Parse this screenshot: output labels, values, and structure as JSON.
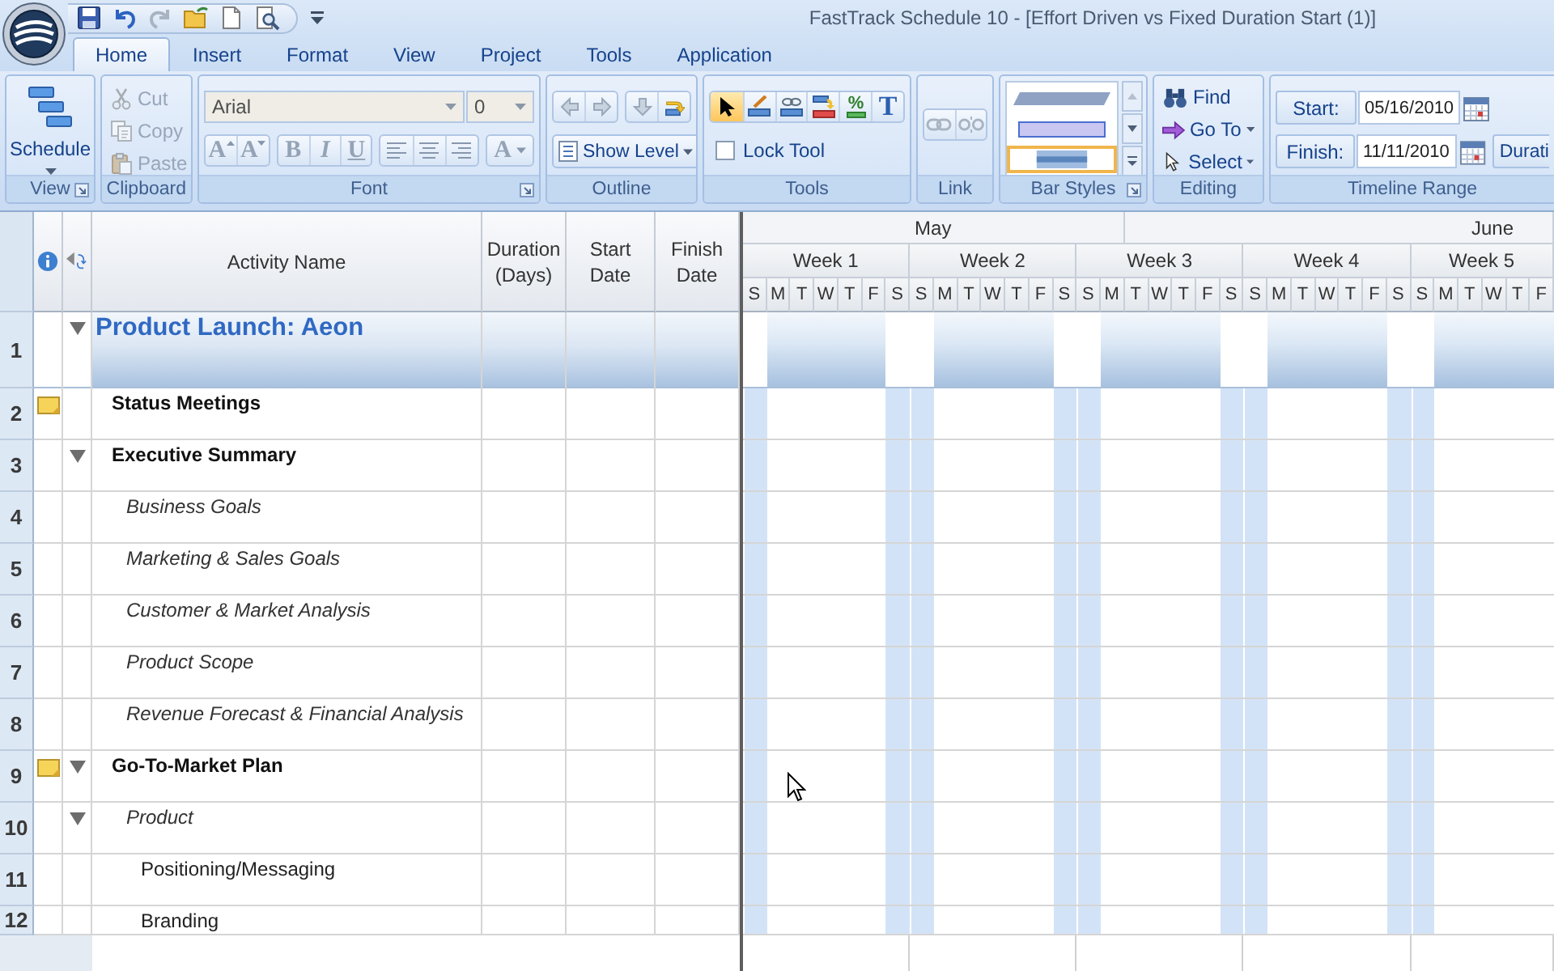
{
  "window": {
    "title": "FastTrack Schedule 10 - [Effort Driven vs Fixed Duration Start (1)]"
  },
  "ribbon_tabs": [
    {
      "label": "Home",
      "selected": true
    },
    {
      "label": "Insert",
      "selected": false
    },
    {
      "label": "Format",
      "selected": false
    },
    {
      "label": "View",
      "selected": false
    },
    {
      "label": "Project",
      "selected": false
    },
    {
      "label": "Tools",
      "selected": false
    },
    {
      "label": "Application",
      "selected": false
    }
  ],
  "ribbon_groups": [
    {
      "kind": "view",
      "label": "View",
      "launcher": true,
      "button": {
        "label": "Schedule"
      }
    },
    {
      "kind": "clipboard",
      "label": "Clipboard",
      "launcher": false,
      "items": [
        {
          "label": "Cut",
          "disabled": true
        },
        {
          "label": "Copy",
          "disabled": true
        },
        {
          "label": "Paste",
          "disabled": true
        }
      ]
    },
    {
      "kind": "font",
      "label": "Font",
      "launcher": true,
      "disabled": true,
      "font": {
        "value": "Arial"
      },
      "size": {
        "value": "0"
      },
      "size_buttons": [
        {
          "label": "A"
        },
        {
          "label": "A"
        }
      ],
      "style_buttons": [
        {
          "label": "B"
        },
        {
          "label": "I"
        },
        {
          "label": "U"
        }
      ],
      "color_button": {
        "label": "A"
      }
    },
    {
      "kind": "outline",
      "label": "Outline",
      "launcher": false,
      "dropdown": {
        "label": "Show Level"
      }
    },
    {
      "kind": "tools",
      "label": "Tools",
      "launcher": false,
      "tools": [
        {
          "selected": true
        },
        {
          "selected": false
        },
        {
          "selected": false
        },
        {
          "selected": false
        },
        {
          "label": "%",
          "selected": false
        },
        {
          "label": "T",
          "selected": false
        }
      ],
      "checkbox": {
        "label": "Lock Tool",
        "checked": false
      }
    },
    {
      "kind": "link",
      "label": "Link",
      "launcher": false,
      "disabled": true
    },
    {
      "kind": "bar_styles",
      "label": "Bar Styles",
      "launcher": true,
      "styles": [
        {
          "selected": false
        },
        {
          "selected": false
        },
        {
          "selected": true
        }
      ]
    },
    {
      "kind": "editing",
      "label": "Editing",
      "launcher": false,
      "items": [
        {
          "label": "Find",
          "dropdown": false
        },
        {
          "label": "Go To",
          "dropdown": true
        },
        {
          "label": "Select",
          "dropdown": true
        }
      ]
    },
    {
      "kind": "timeline",
      "label": "Timeline Range",
      "launcher": false,
      "start": {
        "label": "Start:",
        "value": "05/16/2010"
      },
      "finish": {
        "label": "Finish:",
        "value": "11/11/2010"
      },
      "button": {
        "label": "Durati"
      }
    }
  ],
  "grid": {
    "columns": [
      {
        "label": "Activity Name"
      },
      {
        "label": "Duration (Days)"
      },
      {
        "label": "Start Date"
      },
      {
        "label": "Finish Date"
      }
    ],
    "rows": [
      {
        "number": "1",
        "name": "Product Launch: Aeon",
        "note": false,
        "expanded": true,
        "children": [
          {
            "number": "2",
            "name": "Status Meetings",
            "note": true
          },
          {
            "number": "3",
            "name": "Executive Summary",
            "note": false,
            "expanded": true,
            "children": [
              {
                "number": "4",
                "name": "Business Goals",
                "note": false
              },
              {
                "number": "5",
                "name": "Marketing & Sales Goals",
                "note": false
              },
              {
                "number": "6",
                "name": "Customer & Market Analysis",
                "note": false
              },
              {
                "number": "7",
                "name": "Product Scope",
                "note": false
              },
              {
                "number": "8",
                "name": "Revenue Forecast & Financial Analysis",
                "note": false
              }
            ]
          },
          {
            "number": "9",
            "name": "Go-To-Market Plan",
            "note": true,
            "expanded": true,
            "children": [
              {
                "number": "10",
                "name": "Product",
                "note": false,
                "expanded": true,
                "children": [
                  {
                    "number": "11",
                    "name": "Positioning/Messaging",
                    "note": false
                  },
                  {
                    "number": "12",
                    "name": "Branding",
                    "note": false
                  }
                ]
              }
            ]
          }
        ]
      }
    ]
  },
  "timeline": {
    "months": [
      {
        "label": "May"
      },
      {
        "label": "June"
      }
    ],
    "weeks": [
      {
        "label": "Week 1",
        "days": [
          {
            "label": "S",
            "weekend": true,
            "month_start": false
          },
          {
            "label": "M",
            "weekend": false,
            "month_start": false
          },
          {
            "label": "T",
            "weekend": false,
            "month_start": false
          },
          {
            "label": "W",
            "weekend": false,
            "month_start": false
          },
          {
            "label": "T",
            "weekend": false,
            "month_start": false
          },
          {
            "label": "F",
            "weekend": false,
            "month_start": false
          },
          {
            "label": "S",
            "weekend": true,
            "month_start": false
          }
        ]
      },
      {
        "label": "Week 2",
        "days": [
          {
            "label": "S",
            "weekend": true,
            "month_start": false
          },
          {
            "label": "M",
            "weekend": false,
            "month_start": false
          },
          {
            "label": "T",
            "weekend": false,
            "month_start": false
          },
          {
            "label": "W",
            "weekend": false,
            "month_start": false
          },
          {
            "label": "T",
            "weekend": false,
            "month_start": false
          },
          {
            "label": "F",
            "weekend": false,
            "month_start": false
          },
          {
            "label": "S",
            "weekend": true,
            "month_start": false
          }
        ]
      },
      {
        "label": "Week 3",
        "days": [
          {
            "label": "S",
            "weekend": true,
            "month_start": false
          },
          {
            "label": "M",
            "weekend": false,
            "month_start": false
          },
          {
            "label": "T",
            "weekend": false,
            "month_start": true
          },
          {
            "label": "W",
            "weekend": false,
            "month_start": false
          },
          {
            "label": "T",
            "weekend": false,
            "month_start": false
          },
          {
            "label": "F",
            "weekend": false,
            "month_start": false
          },
          {
            "label": "S",
            "weekend": true,
            "month_start": false
          }
        ]
      },
      {
        "label": "Week 4",
        "days": [
          {
            "label": "S",
            "weekend": true,
            "month_start": false
          },
          {
            "label": "M",
            "weekend": false,
            "month_start": false
          },
          {
            "label": "T",
            "weekend": false,
            "month_start": false
          },
          {
            "label": "W",
            "weekend": false,
            "month_start": false
          },
          {
            "label": "T",
            "weekend": false,
            "month_start": false
          },
          {
            "label": "F",
            "weekend": false,
            "month_start": false
          },
          {
            "label": "S",
            "weekend": true,
            "month_start": false
          }
        ]
      },
      {
        "label": "Week 5",
        "days": [
          {
            "label": "S",
            "weekend": true,
            "month_start": false
          },
          {
            "label": "M",
            "weekend": false,
            "month_start": false
          },
          {
            "label": "T",
            "weekend": false,
            "month_start": false
          },
          {
            "label": "W",
            "weekend": false,
            "month_start": false
          },
          {
            "label": "T",
            "weekend": false,
            "month_start": false
          },
          {
            "label": "F",
            "weekend": false,
            "month_start": false
          }
        ]
      }
    ]
  }
}
